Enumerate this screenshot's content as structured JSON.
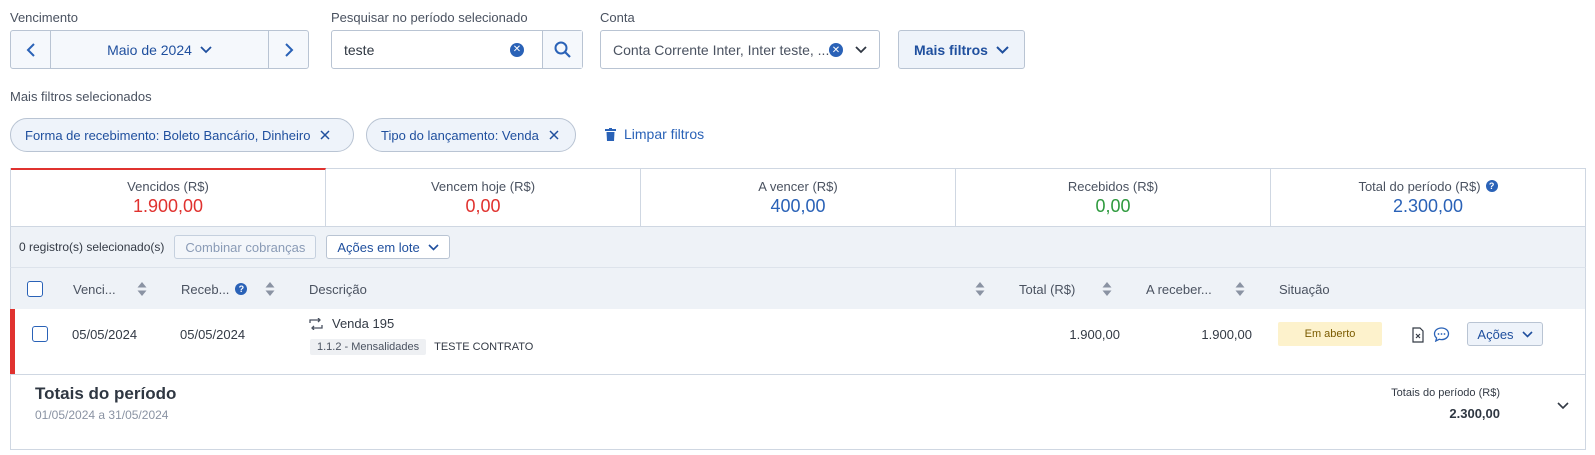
{
  "filters": {
    "vencimento_label": "Vencimento",
    "period_value": "Maio de 2024",
    "search_label": "Pesquisar no período selecionado",
    "search_value": "teste",
    "conta_label": "Conta",
    "conta_value": "Conta Corrente Inter, Inter teste, ...",
    "more_filters_label": "Mais filtros"
  },
  "selected_filters": {
    "title": "Mais filtros selecionados",
    "chips": [
      "Forma de recebimento: Boleto Bancário, Dinheiro",
      "Tipo do lançamento: Venda"
    ],
    "clear_label": "Limpar filtros"
  },
  "summary": [
    {
      "label": "Vencidos (R$)",
      "value": "1.900,00",
      "color": "#e0322f"
    },
    {
      "label": "Vencem hoje (R$)",
      "value": "0,00",
      "color": "#e0322f"
    },
    {
      "label": "A vencer (R$)",
      "value": "400,00",
      "color": "#2a62b7"
    },
    {
      "label": "Recebidos (R$)",
      "value": "0,00",
      "color": "#2e9a3e"
    },
    {
      "label": "Total do período (R$)",
      "value": "2.300,00",
      "color": "#2a62b7"
    }
  ],
  "selection": {
    "count_text": "0 registro(s) selecionado(s)",
    "combine_label": "Combinar cobranças",
    "batch_label": "Ações em lote"
  },
  "table": {
    "headers": {
      "venc": "Venci...",
      "receb": "Receb...",
      "descricao": "Descrição",
      "total": "Total (R$)",
      "a_receber": "A receber...",
      "situacao": "Situação"
    },
    "rows": [
      {
        "vencimento": "05/05/2024",
        "recebimento": "05/05/2024",
        "descricao": "Venda 195",
        "categoria": "1.1.2 - Mensalidades",
        "contrato": "TESTE CONTRATO",
        "total": "1.900,00",
        "a_receber": "1.900,00",
        "situacao": "Em aberto",
        "acoes": "Ações"
      }
    ]
  },
  "totals": {
    "title": "Totais do período",
    "range": "01/05/2024 a 31/05/2024",
    "right_label": "Totais do período (R$)",
    "right_value": "2.300,00"
  },
  "colors": {
    "accent": "#2a62b7",
    "danger": "#e0322f",
    "success": "#2e9a3e",
    "status_open_bg": "#fdf2cc"
  }
}
